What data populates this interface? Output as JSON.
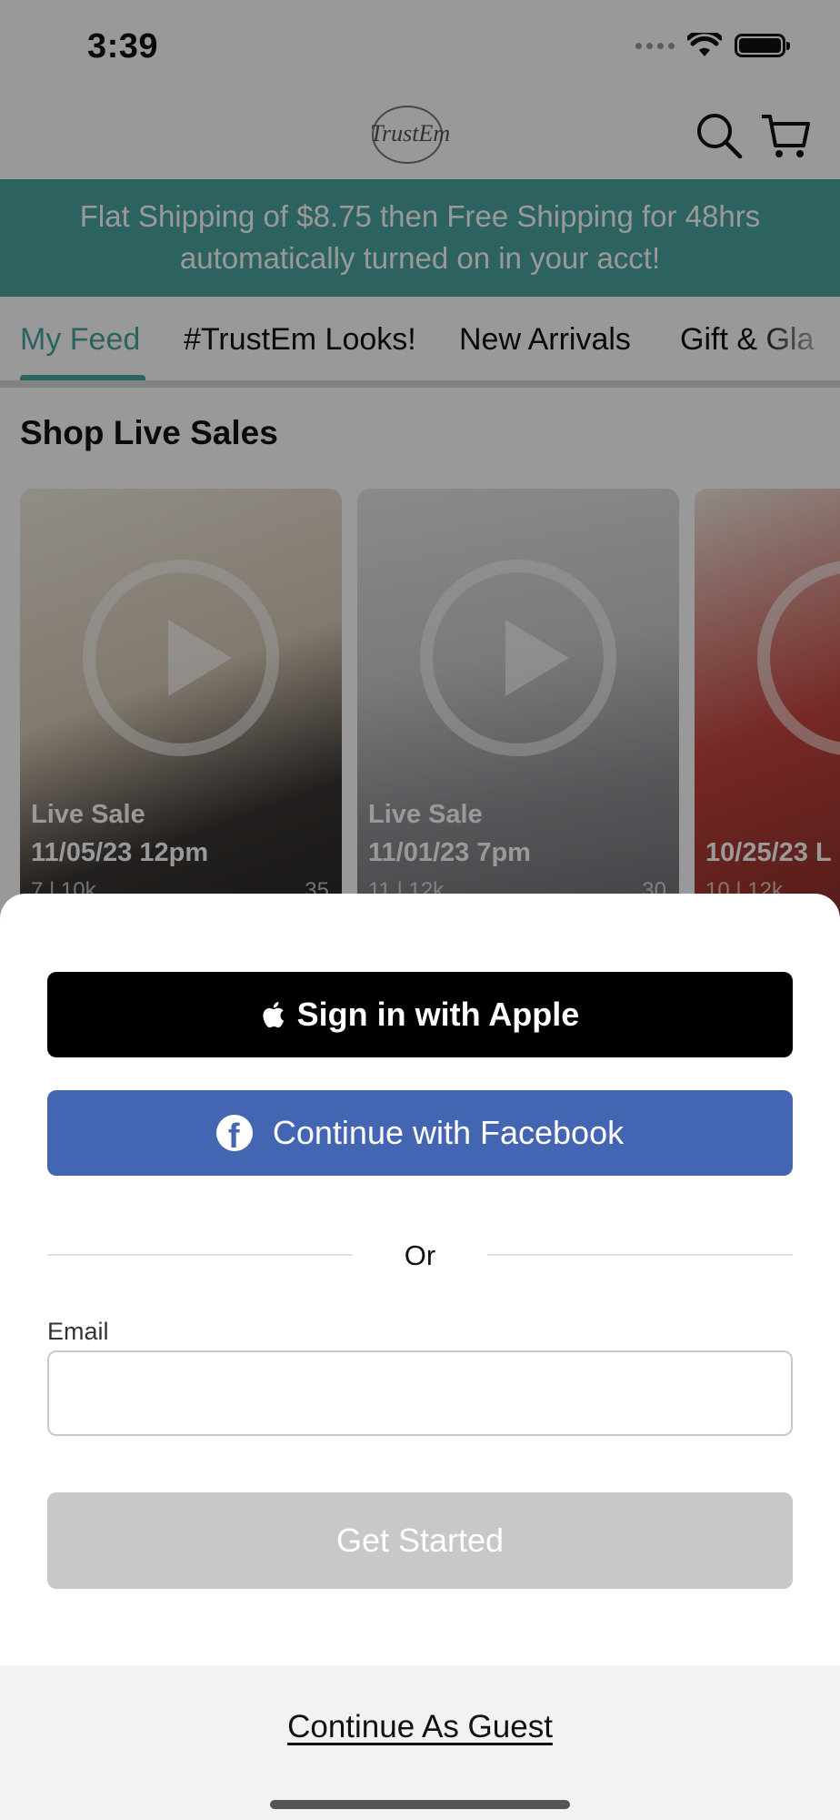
{
  "status_bar": {
    "time": "3:39"
  },
  "header": {
    "logo_text": "TrustEm",
    "icons": {
      "search": "search-icon",
      "cart": "cart-icon"
    }
  },
  "promo_banner": {
    "text": "Flat Shipping of $8.75 then Free Shipping for 48hrs automatically turned on in your acct!"
  },
  "tabs": [
    {
      "label": "My Feed",
      "active": true
    },
    {
      "label": "#TrustEm Looks!"
    },
    {
      "label": "New Arrivals"
    },
    {
      "label": "Gift & Gla"
    }
  ],
  "live_sales": {
    "title": "Shop Live Sales",
    "cards": [
      {
        "label": "Live Sale",
        "date": "11/05/23 12pm",
        "meta": "7 | 10k",
        "views": "35"
      },
      {
        "label": "Live Sale",
        "date": "11/01/23 7pm",
        "meta": "11 | 12k",
        "views": "30"
      },
      {
        "label": "",
        "date": "10/25/23 L",
        "meta": "10 | 12k",
        "views": ""
      }
    ]
  },
  "sheet": {
    "apple_button": "Sign in with Apple",
    "facebook_button": "Continue with Facebook",
    "or_text": "Or",
    "email_label": "Email",
    "email_value": "",
    "email_placeholder": "",
    "get_started_button": "Get Started",
    "guest_link": "Continue As Guest"
  },
  "colors": {
    "accent": "#4aa39e",
    "facebook": "#4466b2",
    "apple": "#000000",
    "disabled": "#c8c8c8"
  }
}
